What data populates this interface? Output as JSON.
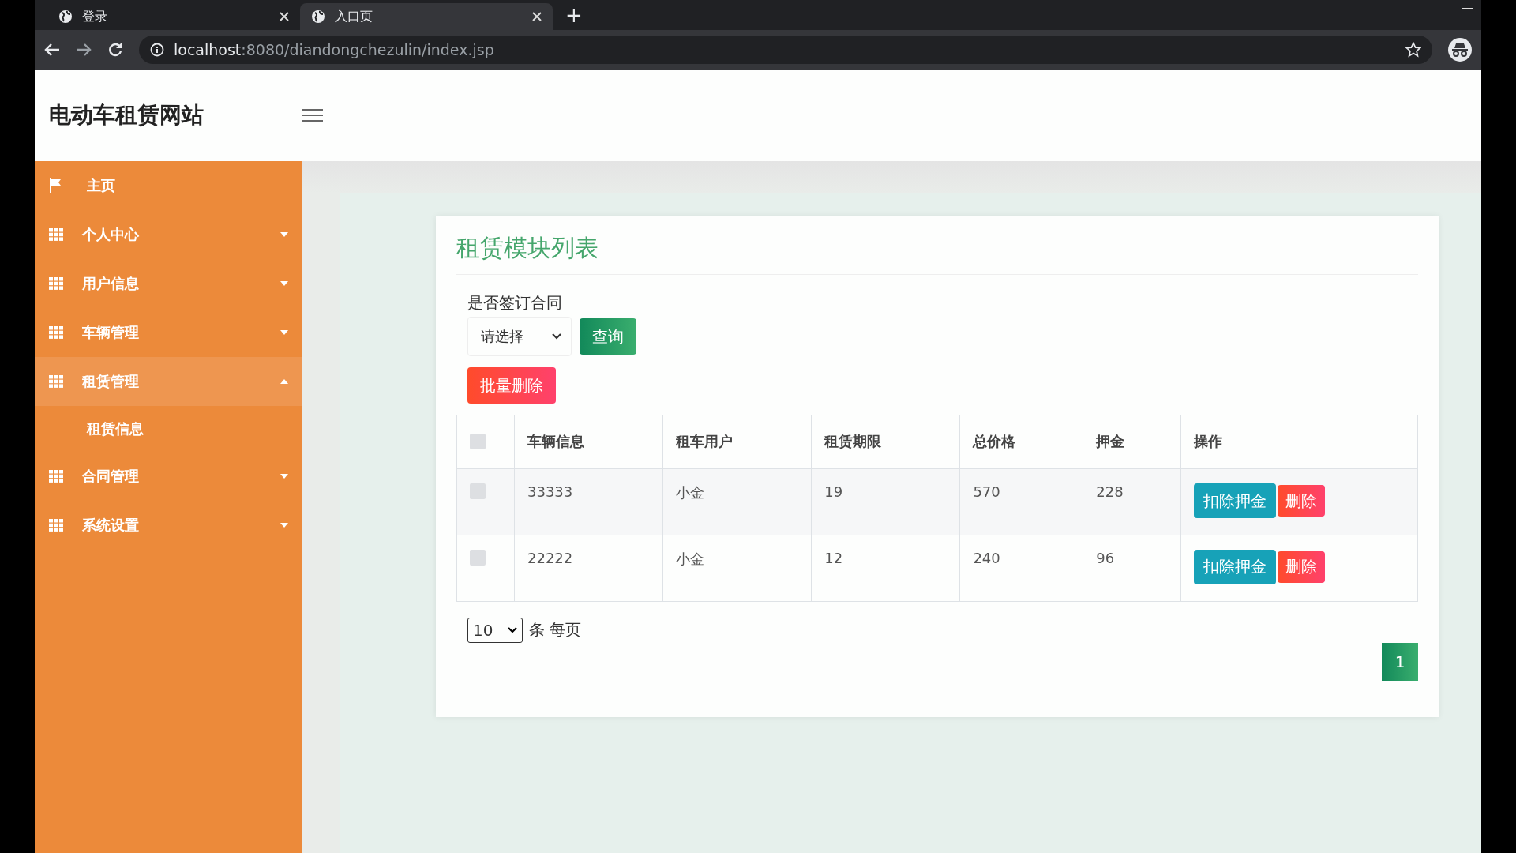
{
  "browser": {
    "tabs": [
      {
        "title": "登录",
        "selected": false
      },
      {
        "title": "入口页",
        "selected": true
      }
    ],
    "new_tab": "+",
    "url_host": "localhost",
    "url_path": ":8080/diandongchezulin/index.jsp"
  },
  "header": {
    "site_title": "电动车租赁网站"
  },
  "sidebar": {
    "items": [
      {
        "label": "主页",
        "kind": "home",
        "selected": false
      },
      {
        "label": "个人中心",
        "kind": "menu",
        "selected": false,
        "expanded": false
      },
      {
        "label": "用户信息",
        "kind": "menu",
        "selected": false,
        "expanded": false
      },
      {
        "label": "车辆管理",
        "kind": "menu",
        "selected": false,
        "expanded": false
      },
      {
        "label": "租赁管理",
        "kind": "menu",
        "selected": true,
        "expanded": true,
        "children": [
          {
            "label": "租赁信息"
          }
        ]
      },
      {
        "label": "合同管理",
        "kind": "menu",
        "selected": false,
        "expanded": false
      },
      {
        "label": "系统设置",
        "kind": "menu",
        "selected": false,
        "expanded": false
      }
    ]
  },
  "panel": {
    "title": "租赁模块列表",
    "filter": {
      "label": "是否签订合同",
      "select_value": "请选择",
      "search_button": "查询"
    },
    "batch_delete_button": "批量删除",
    "table": {
      "header_checked": false,
      "columns": [
        "车辆信息",
        "租车用户",
        "租赁期限",
        "总价格",
        "押金",
        "操作"
      ],
      "rows": [
        {
          "checked": false,
          "cells": [
            "33333",
            "小金",
            "19",
            "570",
            "228"
          ],
          "actions": [
            "扣除押金",
            "删除"
          ]
        },
        {
          "checked": false,
          "cells": [
            "22222",
            "小金",
            "12",
            "240",
            "96"
          ],
          "actions": [
            "扣除押金",
            "删除"
          ]
        }
      ]
    },
    "pagination": {
      "page_size": "10",
      "page_size_label": "条 每页",
      "pages": [
        {
          "label": "1",
          "selected": true
        }
      ]
    }
  }
}
